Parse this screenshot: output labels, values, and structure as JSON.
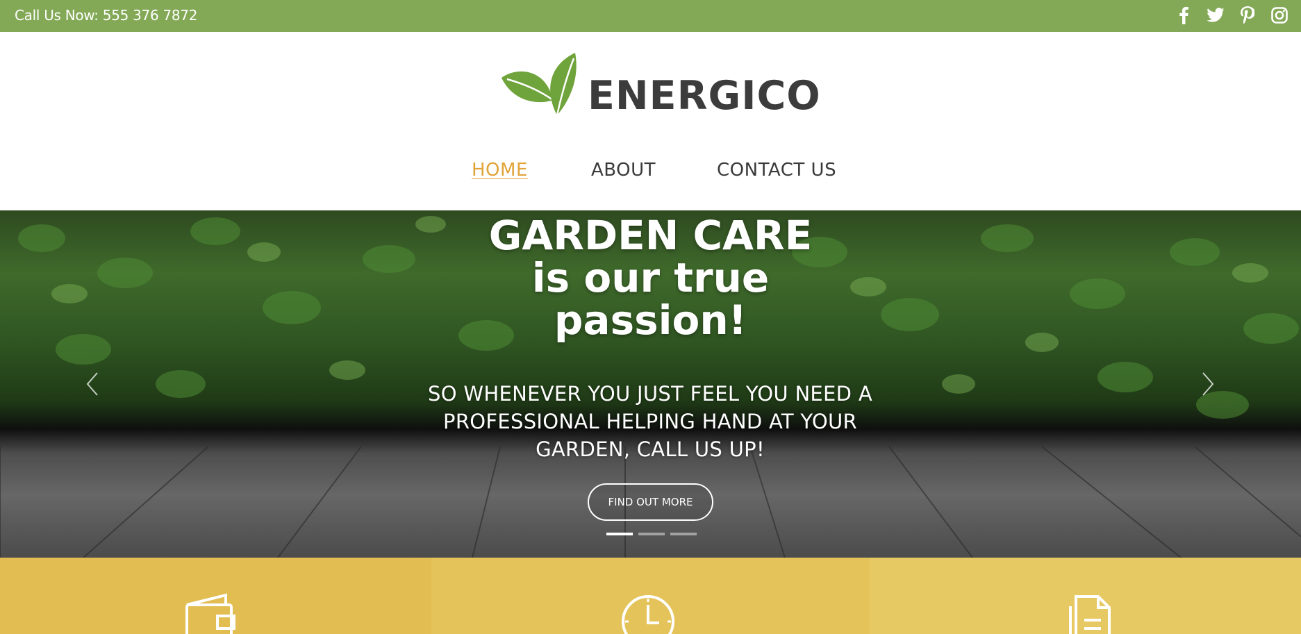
{
  "topbar": {
    "phone": "Call Us Now: 555 376 7872",
    "social_icons": [
      "facebook-icon",
      "twitter-icon",
      "pinterest-icon",
      "instagram-icon"
    ]
  },
  "brand": {
    "name": "ENERGICO",
    "logo_color": "#6fa33b"
  },
  "nav": {
    "items": [
      {
        "label": "HOME",
        "active": true
      },
      {
        "label": "ABOUT",
        "active": false
      },
      {
        "label": "CONTACT US",
        "active": false
      }
    ]
  },
  "hero": {
    "headline_line1": "GARDEN CARE",
    "headline_line2": "is our true",
    "headline_line3": "passion!",
    "subtitle": "SO WHENEVER YOU JUST FEEL YOU NEED A PROFESSIONAL HELPING HAND AT YOUR GARDEN, CALL US UP!",
    "cta_label": "FIND OUT MORE",
    "slides": 3,
    "active_slide": 1
  },
  "features": {
    "icons": [
      "wallet-icon",
      "clock-icon",
      "document-icon"
    ]
  },
  "colors": {
    "topbar": "#83a956",
    "accent": "#e0a43a",
    "feature_1": "#e1bd52",
    "feature_2": "#e4c35a",
    "feature_3": "#e7c963"
  }
}
